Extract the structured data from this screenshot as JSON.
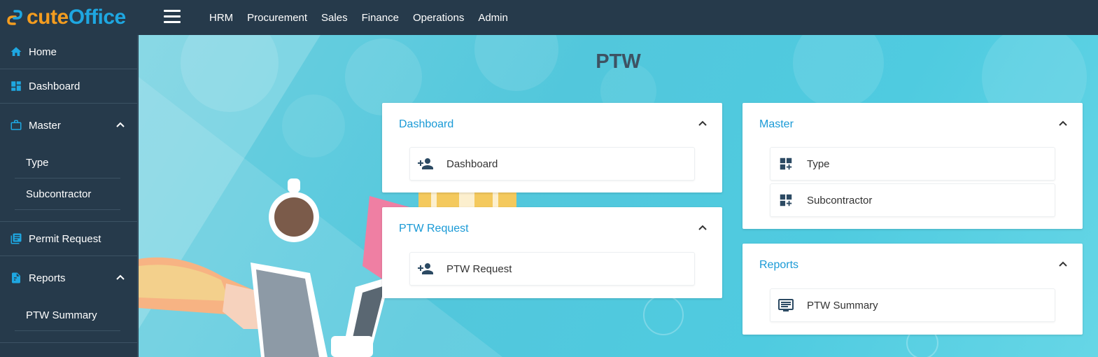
{
  "app": {
    "logo_part1": "cute",
    "logo_part2": "Office"
  },
  "topnav": {
    "items": [
      "HRM",
      "Procurement",
      "Sales",
      "Finance",
      "Operations",
      "Admin"
    ]
  },
  "sidebar": {
    "home": "Home",
    "dashboard": "Dashboard",
    "master": "Master",
    "master_sub": [
      "Type",
      "Subcontractor"
    ],
    "permit_request": "Permit Request",
    "reports": "Reports",
    "reports_sub": [
      "PTW Summary"
    ]
  },
  "page": {
    "title": "PTW"
  },
  "cards": {
    "dashboard": {
      "title": "Dashboard",
      "items": [
        "Dashboard"
      ]
    },
    "ptw_request": {
      "title": "PTW Request",
      "items": [
        "PTW Request"
      ]
    },
    "master": {
      "title": "Master",
      "items": [
        "Type",
        "Subcontractor"
      ]
    },
    "reports": {
      "title": "Reports",
      "items": [
        "PTW Summary"
      ]
    }
  },
  "icons": {
    "home": "home-icon",
    "dashboard": "dashboard-grid-icon",
    "master": "briefcase-icon",
    "permit": "document-list-icon",
    "reports": "report-icon",
    "person_add": "person-add-icon",
    "grid_add": "grid-add-icon",
    "summary": "summary-list-icon"
  },
  "colors": {
    "topbar": "#263a4b",
    "accent": "#1a9ad6",
    "logo_orange": "#f39c1f",
    "logo_blue": "#1ea7e1",
    "icon_dark": "#2c4a63"
  }
}
